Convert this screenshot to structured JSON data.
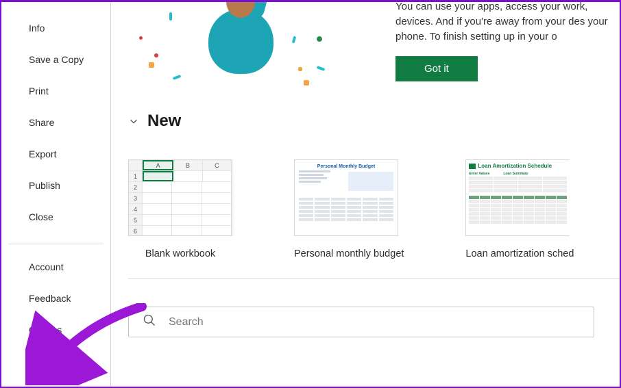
{
  "sidebar": {
    "top": [
      {
        "label": "Info"
      },
      {
        "label": "Save a Copy"
      },
      {
        "label": "Print"
      },
      {
        "label": "Share"
      },
      {
        "label": "Export"
      },
      {
        "label": "Publish"
      },
      {
        "label": "Close"
      }
    ],
    "bottom": [
      {
        "label": "Account"
      },
      {
        "label": "Feedback"
      },
      {
        "label": "Options"
      }
    ]
  },
  "promo": {
    "text": "You can use your apps, access your work, devices. And if you're away from your des your phone. To finish setting up in your o",
    "button_label": "Got it"
  },
  "new_section": {
    "title": "New",
    "templates": [
      {
        "label": "Blank workbook"
      },
      {
        "label": "Personal monthly budget"
      },
      {
        "label": "Loan amortization sched"
      }
    ],
    "thumb_budget_title": "Personal Monthly Budget",
    "thumb_loan_title": "Loan Amortization Schedule",
    "thumb_loan_col1": "Enter Values",
    "thumb_loan_col2": "Loan Summary"
  },
  "search": {
    "placeholder": "Search"
  },
  "colors": {
    "accent": "#107c41",
    "annotation": "#9b18d6"
  }
}
